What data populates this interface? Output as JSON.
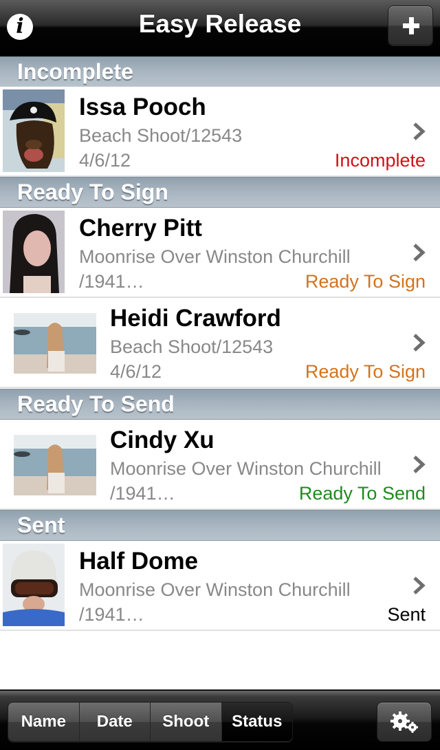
{
  "navbar": {
    "title": "Easy Release",
    "info_icon": "info-icon",
    "add_icon": "plus-icon"
  },
  "sections": [
    {
      "header": "Incomplete",
      "rows": [
        {
          "name": "Issa Pooch",
          "shoot": "Beach Shoot/12543",
          "line2": "4/6/12",
          "status": "Incomplete",
          "status_color": "#d0101a",
          "thumbnail": "dog-in-pirate-hat-photo"
        }
      ]
    },
    {
      "header": "Ready To Sign",
      "rows": [
        {
          "name": "Cherry Pitt",
          "shoot": "Moonrise Over Winston Churchill",
          "line2": "/1941…",
          "status": "Ready To Sign",
          "status_color": "#d2731e",
          "thumbnail": "woman-portrait-photo"
        },
        {
          "name": "Heidi Crawford",
          "shoot": "Beach Shoot/12543",
          "line2": "4/6/12",
          "status": "Ready To Sign",
          "status_color": "#d2731e",
          "thumbnail": "beach-photo"
        }
      ]
    },
    {
      "header": "Ready To Send",
      "rows": [
        {
          "name": "Cindy Xu",
          "shoot": "Moonrise Over Winston Churchill",
          "line2": "/1941…",
          "status": "Ready To Send",
          "status_color": "#1f8a1f",
          "thumbnail": "beach-photo"
        }
      ]
    },
    {
      "header": "Sent",
      "rows": [
        {
          "name": "Half Dome",
          "shoot": "Moonrise Over Winston Churchill",
          "line2": "/1941…",
          "status": "Sent",
          "status_color": "#000000",
          "thumbnail": "helmet-goggles-photo"
        }
      ]
    }
  ],
  "toolbar": {
    "sort_options": [
      "Name",
      "Date",
      "Shoot",
      "Status"
    ],
    "selected_sort": "Status",
    "settings_icon": "gears-icon"
  },
  "colors": {
    "incomplete": "#d0101a",
    "ready_to_sign": "#d2731e",
    "ready_to_send": "#1f8a1f",
    "sent": "#000000",
    "secondary_text": "#888888"
  }
}
